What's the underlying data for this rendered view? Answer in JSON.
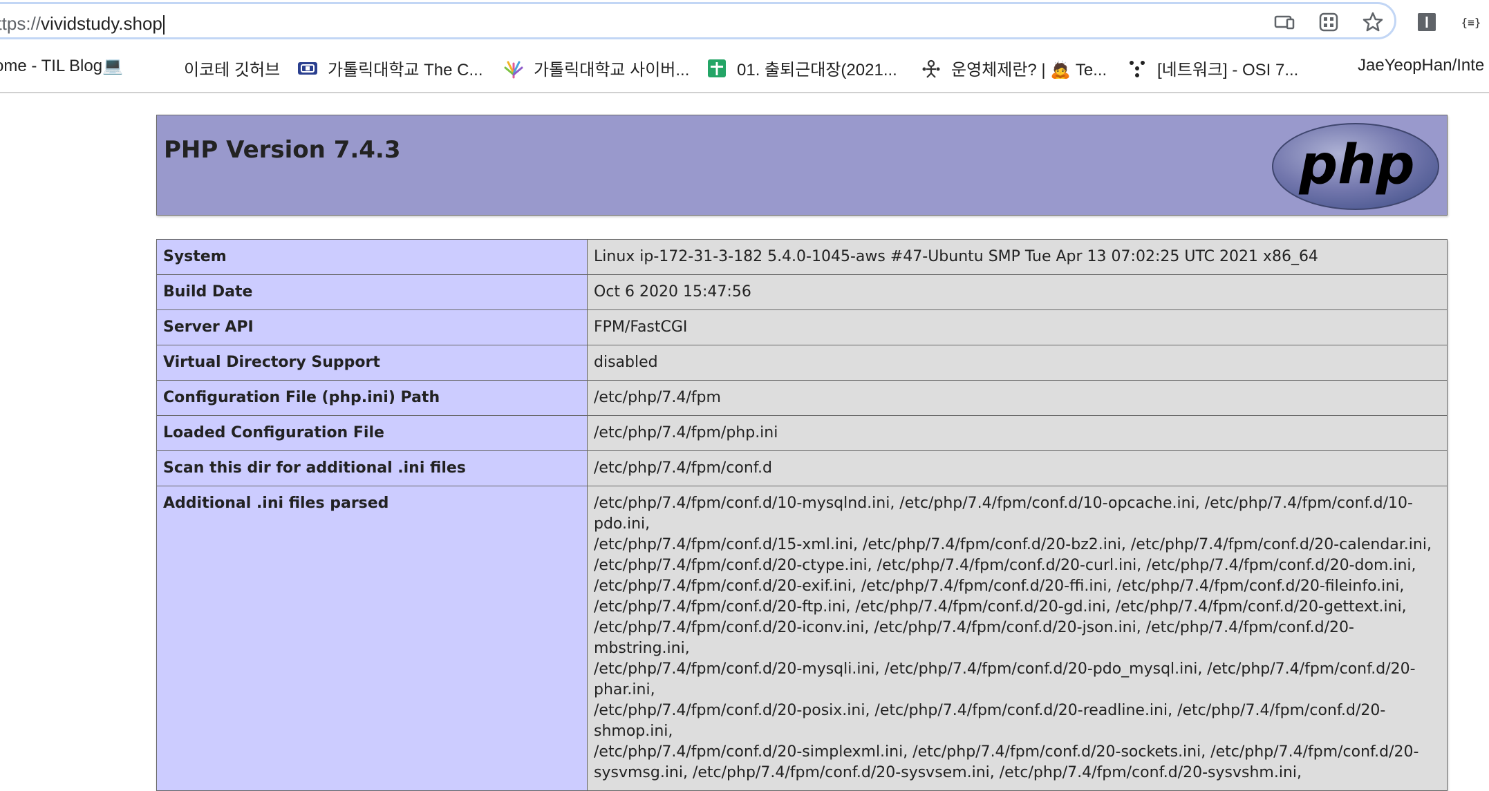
{
  "browser": {
    "url_scheme": "https://",
    "url_host": "vividstudy.shop",
    "bookmarks": [
      {
        "label": "ome - TIL Blog💻",
        "icon": "none"
      },
      {
        "label": "이코테 깃허브",
        "icon": "none"
      },
      {
        "label": "가톨릭대학교 The C...",
        "icon": "catholic-univ-icon"
      },
      {
        "label": "가톨릭대학교 사이버...",
        "icon": "colorful-hand-icon"
      },
      {
        "label": "01. 출퇴근대장(2021...",
        "icon": "google-sheets-icon"
      },
      {
        "label": "운영체제란? | 🙇 Te...",
        "icon": "person-icon"
      },
      {
        "label": "[네트워크] - OSI 7...",
        "icon": "dots-icon"
      },
      {
        "label": "JaeYeopHan/Inte",
        "icon": "none"
      }
    ]
  },
  "phpinfo": {
    "title": "PHP Version 7.4.3",
    "logo_text": "php",
    "rows": [
      {
        "key": "System",
        "value": "Linux ip-172-31-3-182 5.4.0-1045-aws #47-Ubuntu SMP Tue Apr 13 07:02:25 UTC 2021 x86_64"
      },
      {
        "key": "Build Date",
        "value": "Oct 6 2020 15:47:56"
      },
      {
        "key": "Server API",
        "value": "FPM/FastCGI"
      },
      {
        "key": "Virtual Directory Support",
        "value": "disabled"
      },
      {
        "key": "Configuration File (php.ini) Path",
        "value": "/etc/php/7.4/fpm"
      },
      {
        "key": "Loaded Configuration File",
        "value": "/etc/php/7.4/fpm/php.ini"
      },
      {
        "key": "Scan this dir for additional .ini files",
        "value": "/etc/php/7.4/fpm/conf.d"
      }
    ],
    "additional_key": "Additional .ini files parsed",
    "additional_lines": [
      "/etc/php/7.4/fpm/conf.d/10-mysqlnd.ini, /etc/php/7.4/fpm/conf.d/10-opcache.ini, /etc/php/7.4/fpm/conf.d/10-pdo.ini,",
      "/etc/php/7.4/fpm/conf.d/15-xml.ini, /etc/php/7.4/fpm/conf.d/20-bz2.ini, /etc/php/7.4/fpm/conf.d/20-calendar.ini,",
      "/etc/php/7.4/fpm/conf.d/20-ctype.ini, /etc/php/7.4/fpm/conf.d/20-curl.ini, /etc/php/7.4/fpm/conf.d/20-dom.ini,",
      "/etc/php/7.4/fpm/conf.d/20-exif.ini, /etc/php/7.4/fpm/conf.d/20-ffi.ini, /etc/php/7.4/fpm/conf.d/20-fileinfo.ini,",
      "/etc/php/7.4/fpm/conf.d/20-ftp.ini, /etc/php/7.4/fpm/conf.d/20-gd.ini, /etc/php/7.4/fpm/conf.d/20-gettext.ini,",
      "/etc/php/7.4/fpm/conf.d/20-iconv.ini, /etc/php/7.4/fpm/conf.d/20-json.ini, /etc/php/7.4/fpm/conf.d/20-mbstring.ini,",
      "/etc/php/7.4/fpm/conf.d/20-mysqli.ini, /etc/php/7.4/fpm/conf.d/20-pdo_mysql.ini, /etc/php/7.4/fpm/conf.d/20-phar.ini,",
      "/etc/php/7.4/fpm/conf.d/20-posix.ini, /etc/php/7.4/fpm/conf.d/20-readline.ini, /etc/php/7.4/fpm/conf.d/20-shmop.ini,",
      "/etc/php/7.4/fpm/conf.d/20-simplexml.ini, /etc/php/7.4/fpm/conf.d/20-sockets.ini, /etc/php/7.4/fpm/conf.d/20-",
      "sysvmsg.ini, /etc/php/7.4/fpm/conf.d/20-sysvsem.ini, /etc/php/7.4/fpm/conf.d/20-sysvshm.ini,"
    ]
  }
}
